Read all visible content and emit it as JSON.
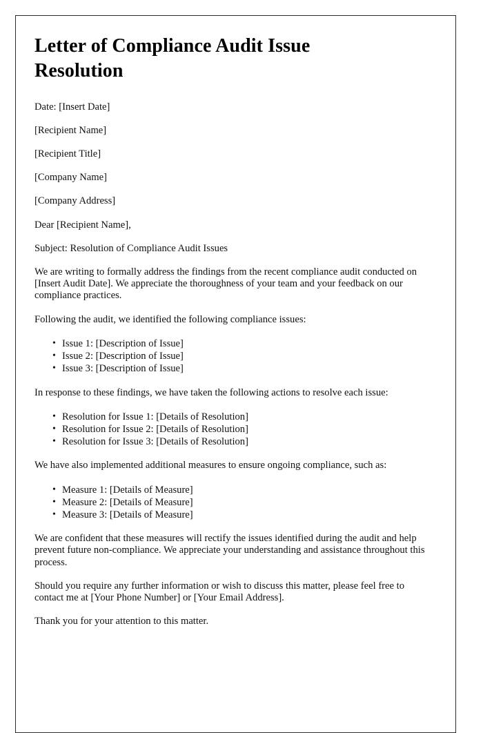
{
  "document": {
    "title": "Letter of Compliance Audit Issue Resolution",
    "date_line": "Date: [Insert Date]",
    "recipient_name": "[Recipient Name]",
    "recipient_title": "[Recipient Title]",
    "company_name": "[Company Name]",
    "company_address": "[Company Address]",
    "salutation": "Dear [Recipient Name],",
    "subject_line": "Subject: Resolution of Compliance Audit Issues",
    "intro_paragraph": "We are writing to formally address the findings from the recent compliance audit conducted on [Insert Audit Date]. We appreciate the thoroughness of your team and your feedback on our compliance practices.",
    "issues_lead": "Following the audit, we identified the following compliance issues:",
    "issues": [
      "Issue 1: [Description of Issue]",
      "Issue 2: [Description of Issue]",
      "Issue 3: [Description of Issue]"
    ],
    "resolutions_lead": "In response to these findings, we have taken the following actions to resolve each issue:",
    "resolutions": [
      "Resolution for Issue 1: [Details of Resolution]",
      "Resolution for Issue 2: [Details of Resolution]",
      "Resolution for Issue 3: [Details of Resolution]"
    ],
    "measures_lead": "We have also implemented additional measures to ensure ongoing compliance, such as:",
    "measures": [
      "Measure 1: [Details of Measure]",
      "Measure 2: [Details of Measure]",
      "Measure 3: [Details of Measure]"
    ],
    "confidence_paragraph": "We are confident that these measures will rectify the issues identified during the audit and help prevent future non-compliance. We appreciate your understanding and assistance throughout this process.",
    "contact_paragraph": "Should you require any further information or wish to discuss this matter, please feel free to contact me at [Your Phone Number] or [Your Email Address].",
    "thanks_paragraph": "Thank you for your attention to this matter."
  },
  "colors": {
    "page_background": "#ffffff",
    "page_border": "#2b2b2b",
    "text": "#111111",
    "title_text": "#000000"
  }
}
